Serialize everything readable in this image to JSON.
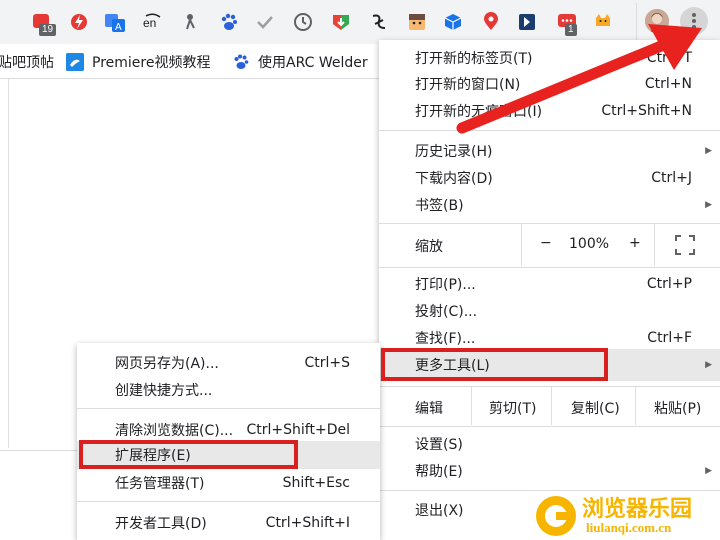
{
  "toolbar": {
    "extensions": [
      {
        "icon": "red-square-icon",
        "badge": "19",
        "color": "#e53935"
      },
      {
        "icon": "flash-icon",
        "color": "#e53935"
      },
      {
        "icon": "translate-icon",
        "color": "#1a73e8"
      },
      {
        "icon": "translator-en-icon",
        "color": "#202124"
      },
      {
        "icon": "figure-icon",
        "color": "#5f6368"
      },
      {
        "icon": "baidu-paw-icon",
        "color": "#2a60d8"
      },
      {
        "icon": "check-icon",
        "color": "#9e9e9e"
      },
      {
        "icon": "clock-icon",
        "color": "#5f6368"
      },
      {
        "icon": "download-shield-icon",
        "color": "#34a853"
      },
      {
        "icon": "calligraphy-icon",
        "color": "#202124"
      },
      {
        "icon": "face-icon",
        "color": "#f5b971"
      },
      {
        "icon": "cube-icon",
        "color": "#1a73e8"
      },
      {
        "icon": "location-pin-icon",
        "color": "#e53935"
      },
      {
        "icon": "arrow-box-icon",
        "color": "#1a3c6e"
      },
      {
        "icon": "chat-bubble-icon",
        "badge": "1",
        "color": "#e53935"
      },
      {
        "icon": "cat-icon",
        "color": "#f9a825"
      }
    ],
    "avatar_icon": "avatar-icon",
    "menu_icon": "kebab-menu-icon"
  },
  "bookmarks": [
    {
      "label": "贴吧顶帖",
      "icon": "none"
    },
    {
      "label": "Premiere视频教程",
      "icon": "premiere-icon"
    },
    {
      "label": "使用ARC Welder",
      "icon": "baidu-paw-icon"
    }
  ],
  "main_menu": {
    "group1": [
      {
        "label": "打开新的标签页(T)",
        "shortcut": "Ctrl+T"
      },
      {
        "label": "打开新的窗口(N)",
        "shortcut": "Ctrl+N"
      },
      {
        "label": "打开新的无痕窗口(I)",
        "shortcut": "Ctrl+Shift+N"
      }
    ],
    "group2": [
      {
        "label": "历史记录(H)",
        "arrow": "▶"
      },
      {
        "label": "下载内容(D)",
        "shortcut": "Ctrl+J"
      },
      {
        "label": "书签(B)",
        "arrow": "▶"
      }
    ],
    "zoom": {
      "label": "缩放",
      "minus": "−",
      "value": "100%",
      "plus": "+"
    },
    "group3": [
      {
        "label": "打印(P)...",
        "shortcut": "Ctrl+P"
      },
      {
        "label": "投射(C)..."
      },
      {
        "label": "查找(F)...",
        "shortcut": "Ctrl+F"
      },
      {
        "label": "更多工具(L)",
        "arrow": "▶"
      }
    ],
    "edit": {
      "label": "编辑",
      "cut": "剪切(T)",
      "copy": "复制(C)",
      "paste": "粘贴(P)"
    },
    "group4": [
      {
        "label": "设置(S)"
      },
      {
        "label": "帮助(E)",
        "arrow": "▶"
      }
    ],
    "exit": {
      "label": "退出(X)"
    }
  },
  "sub_menu": {
    "group1": [
      {
        "label": "网页另存为(A)...",
        "shortcut": "Ctrl+S"
      },
      {
        "label": "创建快捷方式..."
      }
    ],
    "group2": [
      {
        "label": "清除浏览数据(C)...",
        "shortcut": "Ctrl+Shift+Del"
      },
      {
        "label": "扩展程序(E)"
      },
      {
        "label": "任务管理器(T)",
        "shortcut": "Shift+Esc"
      }
    ],
    "group3": [
      {
        "label": "开发者工具(D)",
        "shortcut": "Ctrl+Shift+I"
      }
    ]
  },
  "annotation_color": "#d9201f",
  "watermark": {
    "title": "浏览器乐园",
    "url": "liulanqi.com.cn"
  }
}
